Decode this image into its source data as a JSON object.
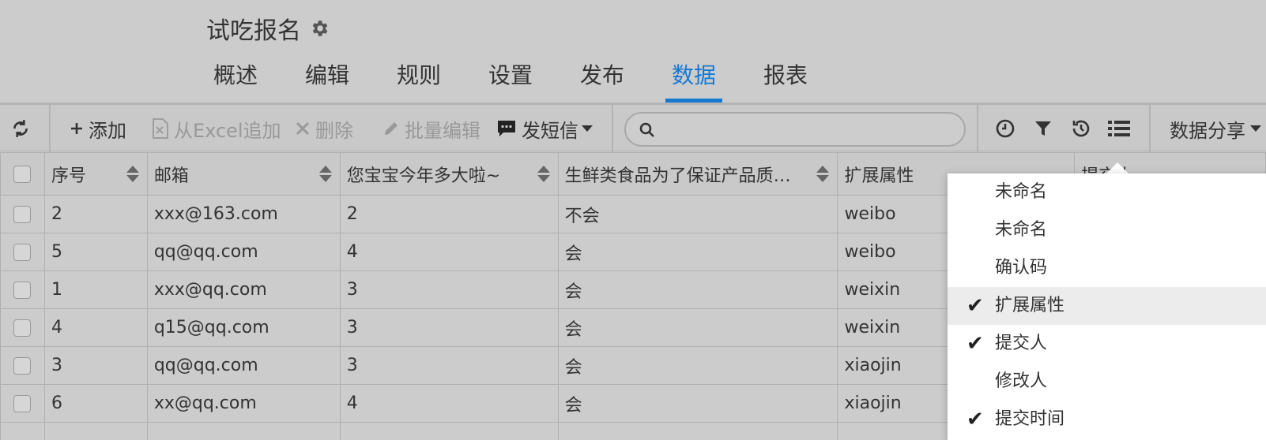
{
  "header": {
    "title": "试吃报名",
    "tabs": [
      {
        "label": "概述"
      },
      {
        "label": "编辑"
      },
      {
        "label": "规则"
      },
      {
        "label": "设置"
      },
      {
        "label": "发布"
      },
      {
        "label": "数据",
        "active": true
      },
      {
        "label": "报表"
      }
    ]
  },
  "toolbar": {
    "add_label": "添加",
    "excel_label": "从Excel追加",
    "delete_label": "删除",
    "batch_edit_label": "批量编辑",
    "sms_label": "发短信",
    "search_placeholder": "",
    "share_label": "数据分享"
  },
  "table": {
    "columns": [
      "序号",
      "邮箱",
      "您宝宝今年多大啦~",
      "生鲜类食品为了保证产品质…",
      "扩展属性",
      "提交人"
    ],
    "rows": [
      [
        "2",
        "xxx@163.com",
        "2",
        "不会",
        "weibo"
      ],
      [
        "5",
        "qq@qq.com",
        "4",
        "会",
        "weibo"
      ],
      [
        "1",
        "xxx@qq.com",
        "3",
        "会",
        "weixin"
      ],
      [
        "4",
        "q15@qq.com",
        "3",
        "会",
        "weixin"
      ],
      [
        "3",
        "qq@qq.com",
        "3",
        "会",
        "xiaojin"
      ],
      [
        "6",
        "xx@qq.com",
        "4",
        "会",
        "xiaojin"
      ]
    ]
  },
  "column_menu": {
    "items": [
      {
        "label": "未命名",
        "checked": false
      },
      {
        "label": "未命名",
        "checked": false
      },
      {
        "label": "确认码",
        "checked": false
      },
      {
        "label": "扩展属性",
        "checked": true
      },
      {
        "label": "提交人",
        "checked": true
      },
      {
        "label": "修改人",
        "checked": false
      },
      {
        "label": "提交时间",
        "checked": true
      }
    ]
  },
  "colors": {
    "accent": "#1678d2",
    "background": "#cccccc"
  }
}
